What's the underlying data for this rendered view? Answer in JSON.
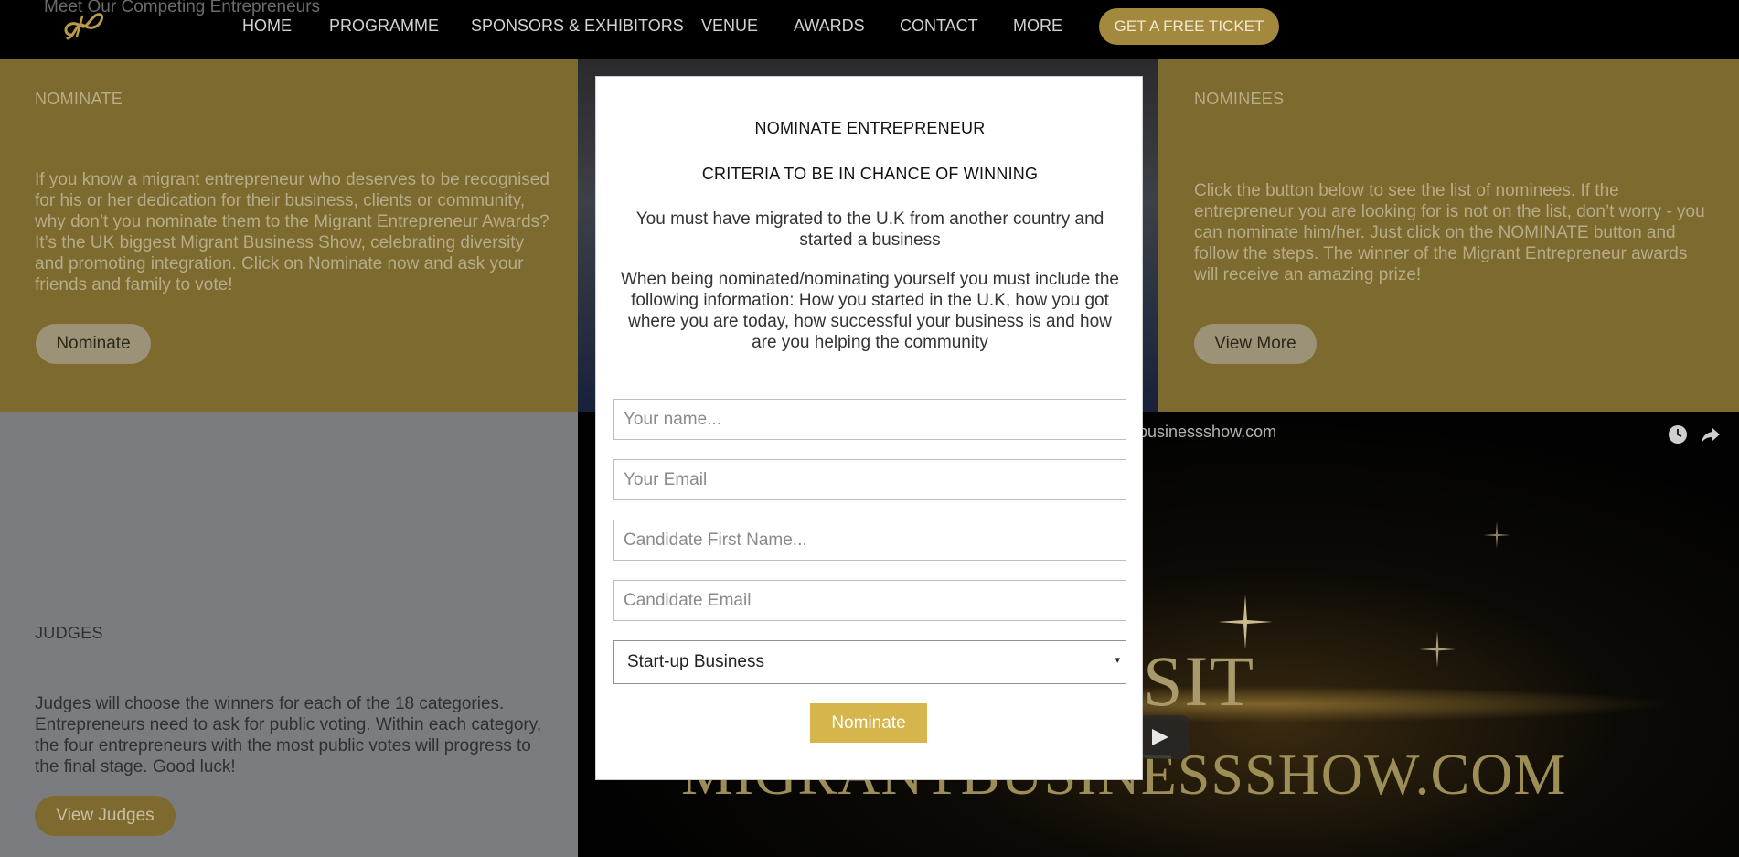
{
  "colors": {
    "brand_gold": "#d6b54c",
    "panel_gold": "#7d6a2f",
    "nav_bg": "#000000"
  },
  "nav": {
    "ghost_text": "Meet Our Competing Entrepreneurs",
    "logo_icon": "script-logo-icon",
    "items": [
      "HOME",
      "PROGRAMME",
      "SPONSORS & EXHIBITORS",
      "VENUE",
      "AWARDS",
      "CONTACT",
      "MORE"
    ],
    "cta": "GET A FREE TICKET"
  },
  "nominate_panel": {
    "title": "NOMINATE",
    "text": "If you know a migrant entrepreneur who deserves to be recognised for his or her dedication for their business, clients or community, why don’t you nominate them to the Migrant Entrepreneur Awards? It’s the UK biggest Migrant Business Show, celebrating diversity and promoting integration. Click on Nominate now and ask your friends and family to vote!",
    "button": "Nominate"
  },
  "nominees_panel": {
    "title": "NOMINEES",
    "text": "Click the button below to see the list of nominees. If the entrepreneur you are looking for is not on the list, don’t worry - you can nominate him/her. Just click on the NOMINATE button and follow the steps. The winner of the Migrant Entrepreneur awards will receive an amazing prize!",
    "button": "View More"
  },
  "judges_panel": {
    "title": "JUDGES",
    "text": "Judges will choose the winners for each of the 18 categories. Entrepreneurs need to ask for public voting. Within each category, the four entrepreneurs with the most public votes will progress to the final stage. Good luck!",
    "button": "View Judges"
  },
  "video": {
    "url_fragment": "ntbusinessshow.com",
    "big_text_1": "SIT",
    "big_text_2": "MIGRANTBUSINESSSHOW.COM",
    "icons": [
      "watch-later-icon",
      "share-icon",
      "play-icon"
    ]
  },
  "modal": {
    "title": "NOMINATE ENTREPRENEUR",
    "subtitle": "CRITERIA TO BE IN CHANCE OF WINNING",
    "para1": "You must have migrated to the U.K from another country and started a business",
    "para2": "When being nominated/nominating yourself you must include the following information: How you started in the U.K, how you got where you are today, how successful your business is and how are you helping the community",
    "fields": {
      "name_placeholder": "Your name...",
      "email_placeholder": "Your Email",
      "candidate_first_placeholder": "Candidate First Name...",
      "candidate_email_placeholder": "Candidate Email"
    },
    "category_select": "Start-up Business",
    "select_arrow": "▾",
    "submit": "Nominate"
  }
}
